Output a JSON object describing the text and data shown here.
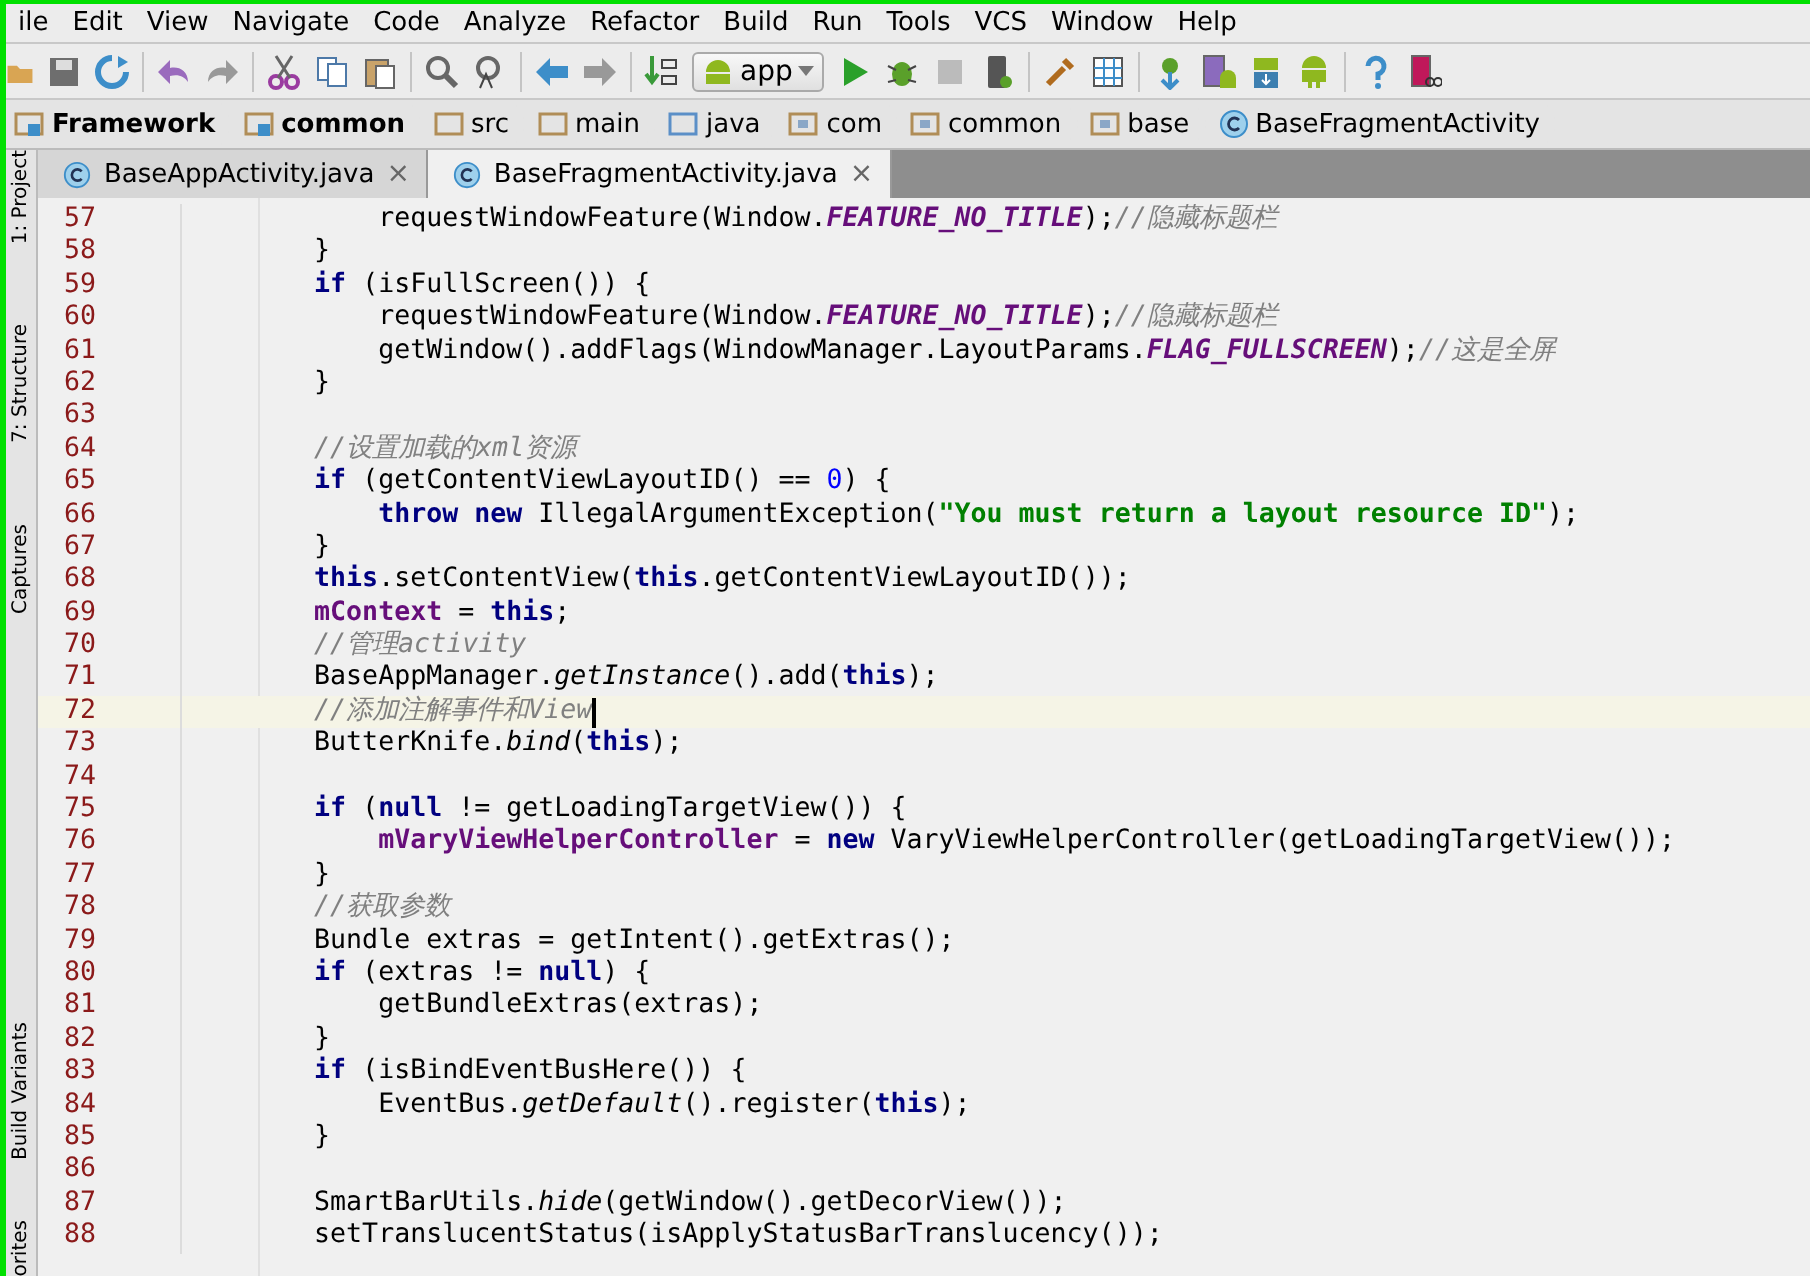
{
  "menu": [
    "ile",
    "Edit",
    "View",
    "Navigate",
    "Code",
    "Analyze",
    "Refactor",
    "Build",
    "Run",
    "Tools",
    "VCS",
    "Window",
    "Help"
  ],
  "toolbar": {
    "run_config": "app"
  },
  "breadcrumbs": [
    {
      "label": "Framework",
      "kind": "module"
    },
    {
      "label": "common",
      "kind": "module"
    },
    {
      "label": "src",
      "kind": "folder"
    },
    {
      "label": "main",
      "kind": "folder"
    },
    {
      "label": "java",
      "kind": "source"
    },
    {
      "label": "com",
      "kind": "package"
    },
    {
      "label": "common",
      "kind": "package"
    },
    {
      "label": "base",
      "kind": "package"
    },
    {
      "label": "BaseFragmentActivity",
      "kind": "class"
    }
  ],
  "tabs": [
    {
      "label": "BaseAppActivity.java",
      "close": "×",
      "selected": false
    },
    {
      "label": "BaseFragmentActivity.java",
      "close": "×",
      "selected": true
    }
  ],
  "tool_windows_top": [
    "1: Project",
    "7: Structure",
    "Captures"
  ],
  "tool_windows_bottom": [
    "Build Variants",
    "orites"
  ],
  "editor": {
    "lines": [
      {
        "number": "57",
        "current": false,
        "tokens": [
          {
            "t": "            requestWindowFeature(Window.",
            "kind": "plain"
          },
          {
            "t": "FEATURE_NO_TITLE",
            "kind": "constant"
          },
          {
            "t": ");",
            "kind": "plain"
          },
          {
            "t": "//隐藏标题栏",
            "kind": "comment"
          }
        ]
      },
      {
        "number": "58",
        "current": false,
        "tokens": [
          {
            "t": "        }",
            "kind": "plain"
          }
        ]
      },
      {
        "number": "59",
        "current": false,
        "tokens": [
          {
            "t": "        if",
            "kind": "keyword"
          },
          {
            "t": " (isFullScreen()) {",
            "kind": "plain"
          }
        ]
      },
      {
        "number": "60",
        "current": false,
        "tokens": [
          {
            "t": "            requestWindowFeature(Window.",
            "kind": "plain"
          },
          {
            "t": "FEATURE_NO_TITLE",
            "kind": "constant"
          },
          {
            "t": ");",
            "kind": "plain"
          },
          {
            "t": "//隐藏标题栏",
            "kind": "comment"
          }
        ]
      },
      {
        "number": "61",
        "current": false,
        "tokens": [
          {
            "t": "            getWindow().addFlags(WindowManager.LayoutParams.",
            "kind": "plain"
          },
          {
            "t": "FLAG_FULLSCREEN",
            "kind": "constant"
          },
          {
            "t": ");",
            "kind": "plain"
          },
          {
            "t": "//这是全屏",
            "kind": "comment"
          }
        ]
      },
      {
        "number": "62",
        "current": false,
        "tokens": [
          {
            "t": "        }",
            "kind": "plain"
          }
        ]
      },
      {
        "number": "63",
        "current": false
      },
      {
        "number": "64",
        "current": false,
        "tokens": [
          {
            "t": "        //设置加载的xml资源",
            "kind": "comment"
          }
        ]
      },
      {
        "number": "65",
        "current": false,
        "tokens": [
          {
            "t": "        if",
            "kind": "keyword"
          },
          {
            "t": " (getContentViewLayoutID() == ",
            "kind": "plain"
          },
          {
            "t": "0",
            "kind": "number"
          },
          {
            "t": ") {",
            "kind": "plain"
          }
        ]
      },
      {
        "number": "66",
        "current": false,
        "tokens": [
          {
            "t": "            throw new",
            "kind": "keyword"
          },
          {
            "t": " IllegalArgumentException(",
            "kind": "plain"
          },
          {
            "t": "\"You must return a layout resource ID\"",
            "kind": "string"
          },
          {
            "t": ");",
            "kind": "plain"
          }
        ]
      },
      {
        "number": "67",
        "current": false,
        "tokens": [
          {
            "t": "        }",
            "kind": "plain"
          }
        ]
      },
      {
        "number": "68",
        "current": false,
        "tokens": [
          {
            "t": "        this",
            "kind": "keyword"
          },
          {
            "t": ".setContentView(",
            "kind": "plain"
          },
          {
            "t": "this",
            "kind": "keyword"
          },
          {
            "t": ".getContentViewLayoutID());",
            "kind": "plain"
          }
        ]
      },
      {
        "number": "69",
        "current": false,
        "tokens": [
          {
            "t": "        mContext",
            "kind": "field"
          },
          {
            "t": " = ",
            "kind": "plain"
          },
          {
            "t": "this",
            "kind": "keyword"
          },
          {
            "t": ";",
            "kind": "plain"
          }
        ]
      },
      {
        "number": "70",
        "current": false,
        "tokens": [
          {
            "t": "        //管理activity",
            "kind": "comment"
          }
        ]
      },
      {
        "number": "71",
        "current": false,
        "tokens": [
          {
            "t": "        BaseAppManager.",
            "kind": "plain"
          },
          {
            "t": "getInstance",
            "kind": "static"
          },
          {
            "t": "().add(",
            "kind": "plain"
          },
          {
            "t": "this",
            "kind": "keyword"
          },
          {
            "t": ");",
            "kind": "plain"
          }
        ]
      },
      {
        "number": "72",
        "current": true,
        "tokens": [
          {
            "t": "        //添加注解事件和View",
            "kind": "comment"
          }
        ]
      },
      {
        "number": "73",
        "current": false,
        "tokens": [
          {
            "t": "        ButterKnife.",
            "kind": "plain"
          },
          {
            "t": "bind",
            "kind": "static"
          },
          {
            "t": "(",
            "kind": "plain"
          },
          {
            "t": "this",
            "kind": "keyword"
          },
          {
            "t": ");",
            "kind": "plain"
          }
        ]
      },
      {
        "number": "74",
        "current": false
      },
      {
        "number": "75",
        "current": false,
        "tokens": [
          {
            "t": "        if",
            "kind": "keyword"
          },
          {
            "t": " (",
            "kind": "plain"
          },
          {
            "t": "null",
            "kind": "keyword"
          },
          {
            "t": " != getLoadingTargetView()) {",
            "kind": "plain"
          }
        ]
      },
      {
        "number": "76",
        "current": false,
        "tokens": [
          {
            "t": "            mVaryViewHelperController",
            "kind": "field"
          },
          {
            "t": " = ",
            "kind": "plain"
          },
          {
            "t": "new",
            "kind": "keyword"
          },
          {
            "t": " VaryViewHelperController(getLoadingTargetView());",
            "kind": "plain"
          }
        ]
      },
      {
        "number": "77",
        "current": false,
        "tokens": [
          {
            "t": "        }",
            "kind": "plain"
          }
        ]
      },
      {
        "number": "78",
        "current": false,
        "tokens": [
          {
            "t": "        //获取参数",
            "kind": "comment"
          }
        ]
      },
      {
        "number": "79",
        "current": false,
        "tokens": [
          {
            "t": "        Bundle extras = getIntent().getExtras();",
            "kind": "plain"
          }
        ]
      },
      {
        "number": "80",
        "current": false,
        "tokens": [
          {
            "t": "        if",
            "kind": "keyword"
          },
          {
            "t": " (extras != ",
            "kind": "plain"
          },
          {
            "t": "null",
            "kind": "keyword"
          },
          {
            "t": ") {",
            "kind": "plain"
          }
        ]
      },
      {
        "number": "81",
        "current": false,
        "tokens": [
          {
            "t": "            getBundleExtras(extras);",
            "kind": "plain"
          }
        ]
      },
      {
        "number": "82",
        "current": false,
        "tokens": [
          {
            "t": "        }",
            "kind": "plain"
          }
        ]
      },
      {
        "number": "83",
        "current": false,
        "tokens": [
          {
            "t": "        if",
            "kind": "keyword"
          },
          {
            "t": " (isBindEventBusHere()) {",
            "kind": "plain"
          }
        ]
      },
      {
        "number": "84",
        "current": false,
        "tokens": [
          {
            "t": "            EventBus.",
            "kind": "plain"
          },
          {
            "t": "getDefault",
            "kind": "static"
          },
          {
            "t": "().register(",
            "kind": "plain"
          },
          {
            "t": "this",
            "kind": "keyword"
          },
          {
            "t": ");",
            "kind": "plain"
          }
        ]
      },
      {
        "number": "85",
        "current": false,
        "tokens": [
          {
            "t": "        }",
            "kind": "plain"
          }
        ]
      },
      {
        "number": "86",
        "current": false
      },
      {
        "number": "87",
        "current": false,
        "tokens": [
          {
            "t": "        SmartBarUtils.",
            "kind": "plain"
          },
          {
            "t": "hide",
            "kind": "static"
          },
          {
            "t": "(getWindow().getDecorView());",
            "kind": "plain"
          }
        ]
      },
      {
        "number": "88",
        "current": false,
        "tokens": [
          {
            "t": "        setTranslucentStatus(isApplyStatusBarTranslucency());",
            "kind": "plain"
          }
        ]
      }
    ]
  }
}
